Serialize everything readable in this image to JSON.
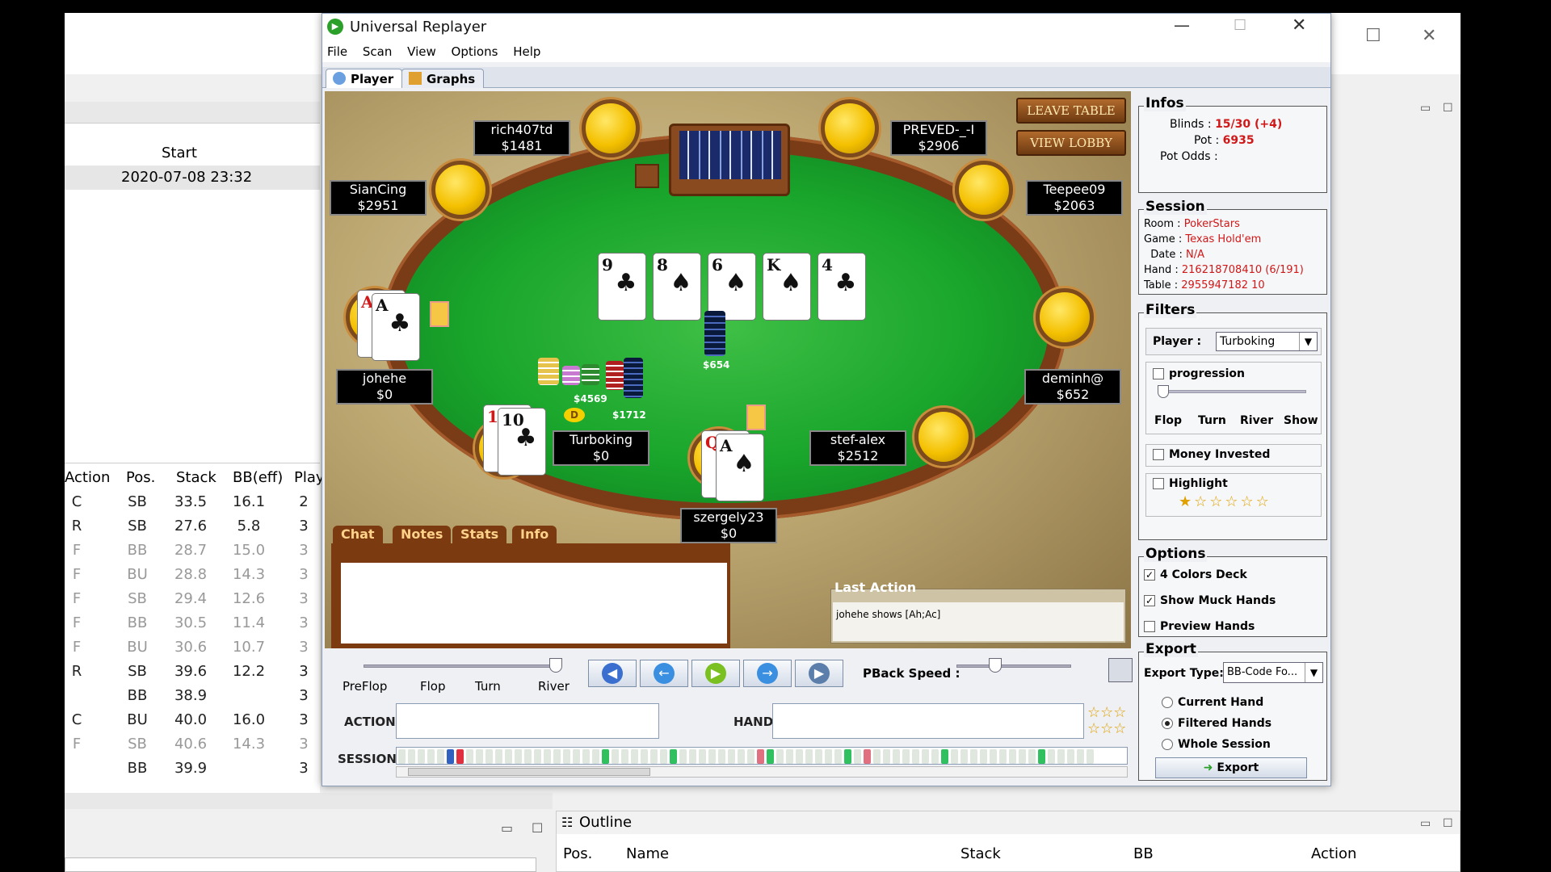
{
  "background_app": {
    "start_header": "Start",
    "start_value": "2020-07-08 23:32",
    "hands_columns": [
      "Action",
      "Pos.",
      "Stack",
      "BB(eff)",
      "Play"
    ],
    "hands_rows": [
      {
        "action": "C",
        "pos": "SB",
        "stack": "33.5",
        "bb": "16.1",
        "play": "2"
      },
      {
        "action": "R",
        "pos": "SB",
        "stack": "27.6",
        "bb": "5.8",
        "play": "3"
      },
      {
        "action": "F",
        "pos": "BB",
        "stack": "28.7",
        "bb": "15.0",
        "play": "3"
      },
      {
        "action": "F",
        "pos": "BU",
        "stack": "28.8",
        "bb": "14.3",
        "play": "3"
      },
      {
        "action": "F",
        "pos": "SB",
        "stack": "29.4",
        "bb": "12.6",
        "play": "3"
      },
      {
        "action": "F",
        "pos": "BB",
        "stack": "30.5",
        "bb": "11.4",
        "play": "3"
      },
      {
        "action": "F",
        "pos": "BU",
        "stack": "30.6",
        "bb": "10.7",
        "play": "3"
      },
      {
        "action": "R",
        "pos": "SB",
        "stack": "39.6",
        "bb": "12.2",
        "play": "3"
      },
      {
        "action": "",
        "pos": "BB",
        "stack": "38.9",
        "bb": "",
        "play": "3"
      },
      {
        "action": "C",
        "pos": "BU",
        "stack": "40.0",
        "bb": "16.0",
        "play": "3"
      },
      {
        "action": "F",
        "pos": "SB",
        "stack": "40.6",
        "bb": "14.3",
        "play": "3"
      },
      {
        "action": "",
        "pos": "BB",
        "stack": "39.9",
        "bb": "",
        "play": "3"
      }
    ],
    "outline_title": "Outline",
    "outline_columns": [
      "Pos.",
      "Name",
      "Stack",
      "BB",
      "Action"
    ]
  },
  "window": {
    "title": "Universal Replayer",
    "menu": [
      "File",
      "Scan",
      "View",
      "Options",
      "Help"
    ],
    "tabs": [
      "Player",
      "Graphs"
    ]
  },
  "table": {
    "leave_table": "LEAVE TABLE",
    "view_lobby": "VIEW LOBBY",
    "players": [
      {
        "name": "rich407td",
        "stack": "$1481"
      },
      {
        "name": "PREVED-_-I",
        "stack": "$2906"
      },
      {
        "name": "SianCing",
        "stack": "$2951"
      },
      {
        "name": "Teepee09",
        "stack": "$2063"
      },
      {
        "name": "johehe",
        "stack": "$0"
      },
      {
        "name": "deminh@",
        "stack": "$652"
      },
      {
        "name": "Turboking",
        "stack": "$0"
      },
      {
        "name": "stef-alex",
        "stack": "$2512"
      },
      {
        "name": "szergely23",
        "stack": "$0"
      }
    ],
    "board": [
      {
        "rank": "9",
        "suit": "♣",
        "color": "black"
      },
      {
        "rank": "8",
        "suit": "♠",
        "color": "black"
      },
      {
        "rank": "6",
        "suit": "♠",
        "color": "black"
      },
      {
        "rank": "K",
        "suit": "♠",
        "color": "black"
      },
      {
        "rank": "4",
        "suit": "♣",
        "color": "black"
      }
    ],
    "johehe_cards": [
      {
        "rank": "A",
        "suit": "♥",
        "color": "red"
      },
      {
        "rank": "A",
        "suit": "♣",
        "color": "black"
      }
    ],
    "turboking_cards": [
      {
        "rank": "10",
        "suit": "♥",
        "color": "red"
      },
      {
        "rank": "10",
        "suit": "♣",
        "color": "black"
      }
    ],
    "szergely_cards": [
      {
        "rank": "Q",
        "suit": "♥",
        "color": "red"
      },
      {
        "rank": "A",
        "suit": "♠",
        "color": "black"
      }
    ],
    "pot_main": "$654",
    "pot_left": "$4569",
    "pot_right": "$1712",
    "dealer": "D",
    "bottom_tabs": [
      "Chat",
      "Notes",
      "Stats",
      "Info"
    ],
    "last_action_title": "Last Action",
    "last_action_text": "johehe shows [Ah;Ac]"
  },
  "infos": {
    "title": "Infos",
    "blinds_label": "Blinds :",
    "blinds_value": "15/30 (+4)",
    "pot_label": "Pot :",
    "pot_value": "6935",
    "potodds_label": "Pot Odds :"
  },
  "session": {
    "title": "Session",
    "room_label": "Room :",
    "room_value": "PokerStars",
    "game_label": "Game :",
    "game_value": "Texas Hold'em",
    "date_label": "Date :",
    "date_value": "N/A",
    "hand_label": "Hand :",
    "hand_value": "216218708410 (6/191)",
    "table_label": "Table :",
    "table_value": "2955947182 10"
  },
  "filters": {
    "title": "Filters",
    "player_label": "Player :",
    "player_value": "Turboking",
    "progression": "progression",
    "streets": [
      "Flop",
      "Turn",
      "River",
      "Show"
    ],
    "money_invested": "Money Invested",
    "highlight": "Highlight"
  },
  "options": {
    "title": "Options",
    "four_colors": "4 Colors Deck",
    "show_muck": "Show Muck Hands",
    "preview": "Preview Hands"
  },
  "export": {
    "title": "Export",
    "type_label": "Export Type:",
    "type_value": "BB-Code Fo...",
    "current": "Current Hand",
    "filtered": "Filtered Hands",
    "whole": "Whole Session",
    "button": "Export"
  },
  "controls": {
    "streets": [
      "PreFlop",
      "Flop",
      "Turn",
      "River"
    ],
    "pback_speed": "PBack Speed :",
    "action_label": "ACTION",
    "hand_label": "HAND",
    "session_label": "SESSION"
  },
  "colors": {
    "red_value": "#d01818",
    "felt": "#19a52b",
    "rail": "#7a3b17"
  }
}
